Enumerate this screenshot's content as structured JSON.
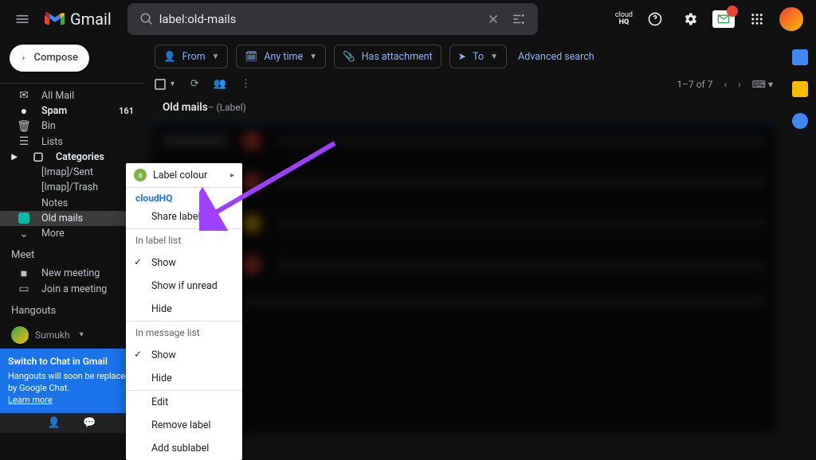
{
  "app": {
    "name": "Gmail",
    "search_value": "label:old-mails"
  },
  "compose": {
    "label": "Compose"
  },
  "sidebar": {
    "items": [
      {
        "label": "All Mail"
      },
      {
        "label": "Spam",
        "count": "161",
        "bold": true
      },
      {
        "label": "Bin"
      },
      {
        "label": "Lists"
      },
      {
        "label": "Categories",
        "bold": true
      },
      {
        "label": "[Imap]/Sent"
      },
      {
        "label": "[Imap]/Trash"
      },
      {
        "label": "Notes"
      },
      {
        "label": "Old mails",
        "selected": true
      },
      {
        "label": "More"
      }
    ],
    "meet_title": "Meet",
    "meet_new": "New meeting",
    "meet_join": "Join a meeting",
    "hangouts_title": "Hangouts",
    "hangouts_user": "Sumukh"
  },
  "promo": {
    "title": "Switch to Chat in Gmail",
    "body": "Hangouts will soon be replaced by Google Chat.",
    "learn": "Learn more"
  },
  "chips": {
    "from": "From",
    "anytime": "Any time",
    "attach": "Has attachment",
    "to": "To",
    "advanced": "Advanced search"
  },
  "toolbar": {
    "pagecount": "1–7 of 7"
  },
  "label_header": {
    "name": "Old mails",
    "suffix": "– (Label)"
  },
  "context_menu": {
    "label_colour": "Label colour",
    "cloudhq": "cloudHQ",
    "share": "Share label ...",
    "section_label_list": "In label list",
    "show": "Show",
    "show_unread": "Show if unread",
    "hide": "Hide",
    "section_message_list": "In message list",
    "edit": "Edit",
    "remove": "Remove label",
    "add_sub": "Add sublabel"
  },
  "colors": {
    "accent": "#1a73e8",
    "link": "#8ab4f8",
    "label_old_mails": "#00bfa5"
  }
}
